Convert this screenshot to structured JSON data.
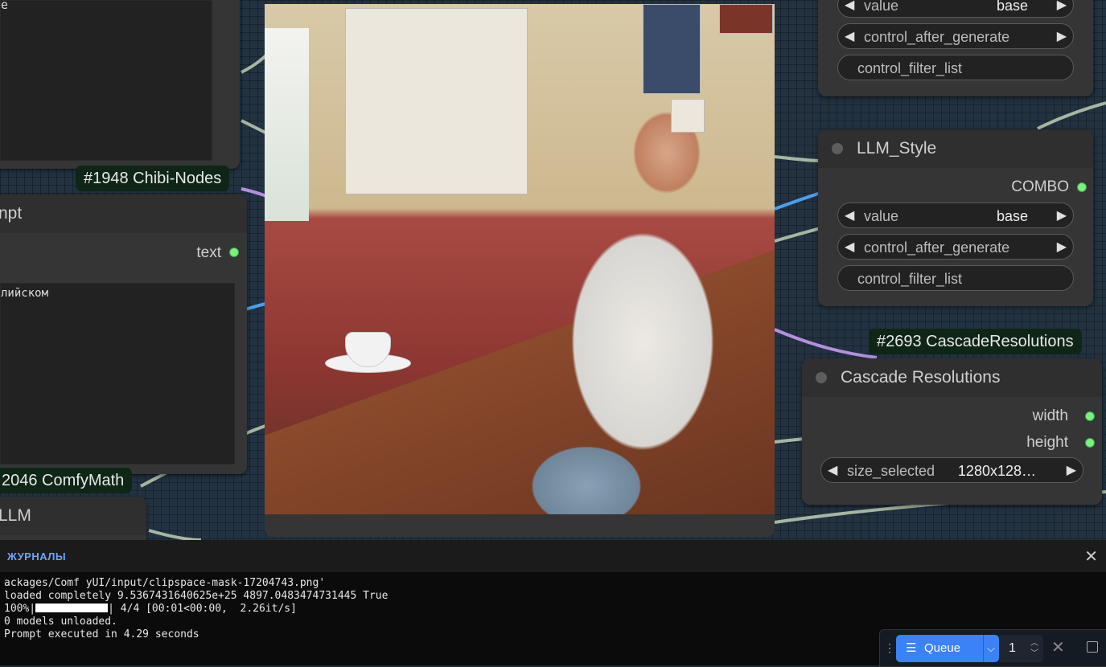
{
  "nodes": {
    "left_top": {
      "text_fragment": "е",
      "badge": "#1948 Chibi-Nodes"
    },
    "prompt_node": {
      "title": "npt",
      "output": "text",
      "text_fragment": "лийском"
    },
    "comfymath": {
      "badge": "2046 ComfyMath"
    },
    "llm_node": {
      "title": "LLM"
    },
    "top_right": {
      "value_label": "value",
      "value": "base",
      "control_label": "control_after_generate",
      "control_value": "",
      "filter_label": "control_filter_list"
    },
    "llm_style": {
      "title": "LLM_Style",
      "output": "COMBO",
      "value_label": "value",
      "value": "base",
      "control_label": "control_after_generate",
      "control_value": "",
      "filter_label": "control_filter_list"
    },
    "cascade": {
      "badge": "#2693 CascadeResolutions",
      "title": "Cascade Resolutions",
      "out_width": "width",
      "out_height": "height",
      "size_label": "size_selected",
      "size_value": "1280x128…"
    }
  },
  "logs": {
    "title": "ЖУРНАЛЫ",
    "lines": [
      "ackages/Comf yUI/input/clipspace-mask-17204743.png'",
      "loaded completely 9.5367431640625e+25 4897.0483474731445 True",
      "0 models unloaded.",
      "Prompt executed in 4.29 seconds"
    ],
    "progress_prefix": "100%|",
    "progress_suffix": "| 4/4 [00:01<00:00,  2.26it/s]",
    "progress_fraction": 1.0
  },
  "queue": {
    "label": "Queue",
    "count": "1",
    "grip": "⋮",
    "icons": [
      "queue-icon",
      "chevron-down-icon",
      "close-icon",
      "square-icon"
    ]
  },
  "colors": {
    "accent": "#3b82f6",
    "socket": "#7cf07c",
    "log_title": "#69a7ff"
  }
}
